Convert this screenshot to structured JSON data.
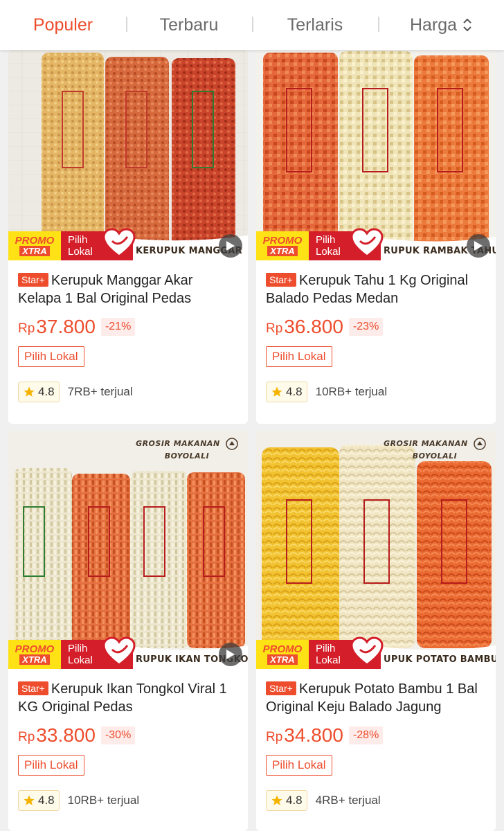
{
  "sortbar": {
    "tabs": [
      {
        "label": "Populer"
      },
      {
        "label": "Terbaru"
      },
      {
        "label": "Terlaris"
      },
      {
        "label": "Harga"
      }
    ]
  },
  "badges": {
    "promo_line1": "PROMO",
    "promo_line2": "XTRA",
    "lokal_line1": "Pilih",
    "lokal_line2": "Lokal",
    "brand_header_line1": "GROSIR MAKANAN",
    "brand_header_line2": "BOYOLALI"
  },
  "products": [
    {
      "strip_name": "KERUPUK MANGGAR",
      "star_tag": "Star+",
      "title": "Kerupuk Manggar Akar Kelapa 1 Bal Original Pedas",
      "currency": "Rp",
      "price": "37.800",
      "discount": "-21%",
      "chip": "Pilih Lokal",
      "rating": "4.8",
      "sold": "7RB+ terjual"
    },
    {
      "strip_name": "RUPUK RAMBAK TAHU",
      "star_tag": "Star+",
      "title": "Kerupuk Tahu 1 Kg Original Balado Pedas Medan",
      "currency": "Rp",
      "price": "36.800",
      "discount": "-23%",
      "chip": "Pilih Lokal",
      "rating": "4.8",
      "sold": "10RB+ terjual"
    },
    {
      "strip_name": "RUPUK IKAN TONGKOL",
      "star_tag": "Star+",
      "title": "Kerupuk Ikan Tongkol Viral 1 KG Original Pedas",
      "currency": "Rp",
      "price": "33.800",
      "discount": "-30%",
      "chip": "Pilih Lokal",
      "rating": "4.8",
      "sold": "10RB+ terjual"
    },
    {
      "strip_name": "UPUK POTATO BAMBU",
      "star_tag": "Star+",
      "title": "Kerupuk Potato Bambu 1 Bal Original Keju Balado Jagung",
      "currency": "Rp",
      "price": "34.800",
      "discount": "-28%",
      "chip": "Pilih Lokal",
      "rating": "4.8",
      "sold": "4RB+ terjual"
    }
  ],
  "colors": {
    "accent": "#ee4d2d",
    "promo_yellow": "#ffe216",
    "lokal_red": "#d41f2a",
    "star": "#f5b301"
  }
}
